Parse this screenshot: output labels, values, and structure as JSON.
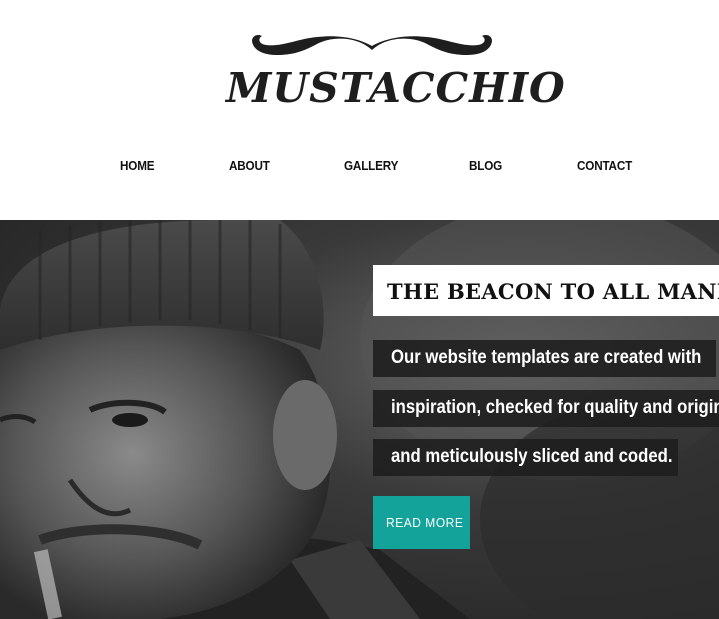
{
  "brand": {
    "logo_text": "MUSTACCHIO",
    "logo_icon": "mustache-icon"
  },
  "nav": {
    "items": [
      {
        "label": "HOME"
      },
      {
        "label": "ABOUT"
      },
      {
        "label": "GALLERY"
      },
      {
        "label": "BLOG"
      },
      {
        "label": "CONTACT"
      }
    ]
  },
  "hero": {
    "headline": "THE BEACON TO ALL MANKIND",
    "lines": [
      "Our website templates are created with",
      "inspiration, checked for quality and originality",
      "and meticulously sliced and coded."
    ],
    "button_label": "READ MORE",
    "image": "portrait-photo"
  },
  "colors": {
    "accent": "#14a39a",
    "text_dark": "#111111",
    "caption_bg": "#1e1e1e"
  }
}
